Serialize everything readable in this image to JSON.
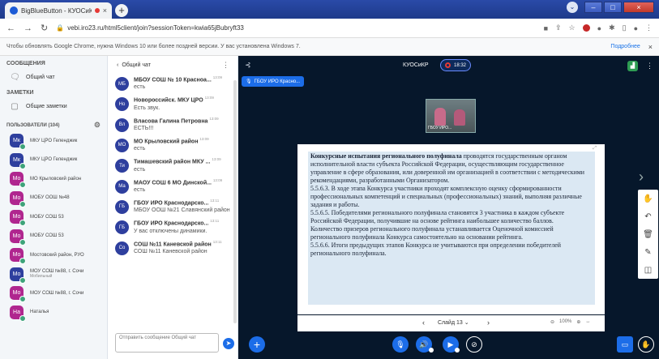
{
  "browser": {
    "tab_title": "BigBlueButton - КУОСиКР - ",
    "tab_close": "×",
    "new_tab": "+",
    "url": "vebi.iro23.ru/html5client/join?sessionToken=kwia65jBubryft33",
    "win_minimize": "–",
    "win_maximize": "□",
    "win_close": "×"
  },
  "notice": {
    "text": "Чтобы обновлять Google Chrome, нужна Windows 10 или более поздней версии. У вас установлена Windows 7.",
    "more": "Подробнее",
    "close": "×"
  },
  "sidebar": {
    "messages_title": "СООБЩЕНИЯ",
    "public_chat": "Общий чат",
    "notes_title": "ЗАМЕТКИ",
    "shared_notes": "Общие заметки",
    "users_title": "ПОЛЬЗОВАТЕЛИ (104)",
    "users": [
      {
        "initials": "Мк",
        "name": "МКУ ЦРО Геленджик",
        "sub": "",
        "color": "blue"
      },
      {
        "initials": "Мк",
        "name": "МКУ ЦРО Геленджик",
        "sub": "",
        "color": "blue"
      },
      {
        "initials": "Мо",
        "name": "МО Крыловский район",
        "sub": "",
        "color": "pink"
      },
      {
        "initials": "Мо",
        "name": "МОБУ ООШ №48",
        "sub": "",
        "color": "pink"
      },
      {
        "initials": "Мо",
        "name": "МОБУ СОШ 53",
        "sub": "",
        "color": "pink"
      },
      {
        "initials": "Мо",
        "name": "МОБУ СОШ 53",
        "sub": "",
        "color": "pink"
      },
      {
        "initials": "Мо",
        "name": "Мостовский район, РУО",
        "sub": "",
        "color": "pink"
      },
      {
        "initials": "Мо",
        "name": "МОУ СОШ №88, г. Сочи",
        "sub": "Мобильный",
        "color": "blue"
      },
      {
        "initials": "Мо",
        "name": "МОУ СОШ №88, г. Сочи",
        "sub": "",
        "color": "pink"
      },
      {
        "initials": "На",
        "name": "Наталья",
        "sub": "",
        "color": "pink"
      }
    ]
  },
  "chat": {
    "header": "Общий чат",
    "back": "‹",
    "messages": [
      {
        "initials": "МБ",
        "name": "МБОУ СОШ № 10 Красноа...",
        "time": "13:09",
        "text": "есть"
      },
      {
        "initials": "Но",
        "name": "Новороссийск. МКУ ЦРО",
        "time": "13:09",
        "text": "Есть звук."
      },
      {
        "initials": "Вл",
        "name": "Власова Галина Петровна",
        "time": "13:09",
        "text": "ЕСТЬ!!!"
      },
      {
        "initials": "МО",
        "name": "МО Крыловский район",
        "time": "13:09",
        "text": "есть"
      },
      {
        "initials": "Ти",
        "name": "Тимашевский район МКУ ...",
        "time": "13:09",
        "text": "есть"
      },
      {
        "initials": "Ма",
        "name": "МАОУ СОШ 6 МО Динской...",
        "time": "13:09",
        "text": "есть"
      },
      {
        "initials": "ГБ",
        "name": "ГБОУ ИРО Краснодарско...",
        "time": "13:11",
        "text": "МБОУ ООШ №21 Славянский район"
      },
      {
        "initials": "ГБ",
        "name": "ГБОУ ИРО Краснодарско...",
        "time": "13:11",
        "text": "У вас отключены динамики."
      },
      {
        "initials": "Со",
        "name": "СОШ №11 Каневской район",
        "time": "13:11",
        "text": "СОШ №11 Каневской район"
      }
    ],
    "input_placeholder": "Отправить сообщение Общий чат",
    "send": "➤"
  },
  "stage": {
    "meeting_title": "КУОСиКР",
    "record_time": "18:32",
    "video_tag": "ГБОУ ИРО Красно...",
    "video_label": "ГБОУ ИРО...",
    "slide": {
      "p1_bold": "Конкурсные испытания регионального полуфинала",
      "p1_rest": " проводятся государственным органом исполнительной власти субъекта Российской Федерации, осуществляющим государственное управление в сфере образования, или доверенной им организацией в соответствии с методическими рекомендациями, разработанными Организатором.",
      "p2": "5.5.6.3. В ходе этапа Конкурса участники проходят комплексную оценку сформированности профессиональных компетенций и специальных (профессиональных) знаний, выполняя различные задания и работы.",
      "p3": "5.5.6.5. Победителями регионального полуфинала становятся 3 участника в каждом субъекте Российской Федерации, получившие на основе рейтинга наибольшее количество баллов.",
      "p4": "Количество призеров регионального полуфинала устанавливается Оценочной комиссией регионального полуфинала Конкурса самостоятельно на основании рейтинга.",
      "p5": "5.5.6.6. Итоги предыдущих этапов Конкурса не учитываются при определении победителей регионального полуфинала."
    },
    "slide_label": "Слайд 13",
    "zoom": "100%"
  }
}
